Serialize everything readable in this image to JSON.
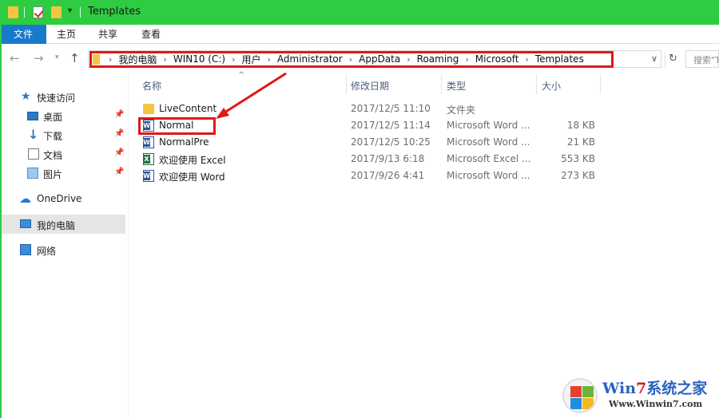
{
  "window": {
    "title": "Templates"
  },
  "ribbon": {
    "tabs": [
      "文件",
      "主页",
      "共享",
      "查看"
    ]
  },
  "address": {
    "crumbs": [
      "我的电脑",
      "WIN10 (C:)",
      "用户",
      "Administrator",
      "AppData",
      "Roaming",
      "Microsoft",
      "Templates"
    ],
    "search_placeholder": "搜索\"Templates\""
  },
  "sidebar": {
    "quick_access": "快速访问",
    "quick_items": [
      "桌面",
      "下载",
      "文档",
      "图片"
    ],
    "onedrive": "OneDrive",
    "this_pc": "我的电脑",
    "network": "网络"
  },
  "columns": {
    "name": "名称",
    "date": "修改日期",
    "type": "类型",
    "size": "大小"
  },
  "files": [
    {
      "name": "LiveContent",
      "date": "2017/12/5 11:10",
      "type": "文件夹",
      "size": "",
      "icon": "folder-icon"
    },
    {
      "name": "Normal",
      "date": "2017/12/5 11:14",
      "type": "Microsoft Word ...",
      "size": "18 KB",
      "icon": "word-icon"
    },
    {
      "name": "NormalPre",
      "date": "2017/12/5 10:25",
      "type": "Microsoft Word ...",
      "size": "21 KB",
      "icon": "word-icon"
    },
    {
      "name": "欢迎使用 Excel",
      "date": "2017/9/13 6:18",
      "type": "Microsoft Excel ...",
      "size": "553 KB",
      "icon": "excel-icon"
    },
    {
      "name": "欢迎使用 Word",
      "date": "2017/9/26 4:41",
      "type": "Microsoft Word ...",
      "size": "273 KB",
      "icon": "word-icon"
    }
  ],
  "watermark": {
    "brand_prefix": "Win",
    "brand_seven": "7",
    "brand_suffix": "系统之家",
    "url": "Www.Winwin7.com"
  },
  "colors": {
    "titlebar": "#2ecc40",
    "file_tab": "#1979ca",
    "highlight": "#e01818"
  }
}
